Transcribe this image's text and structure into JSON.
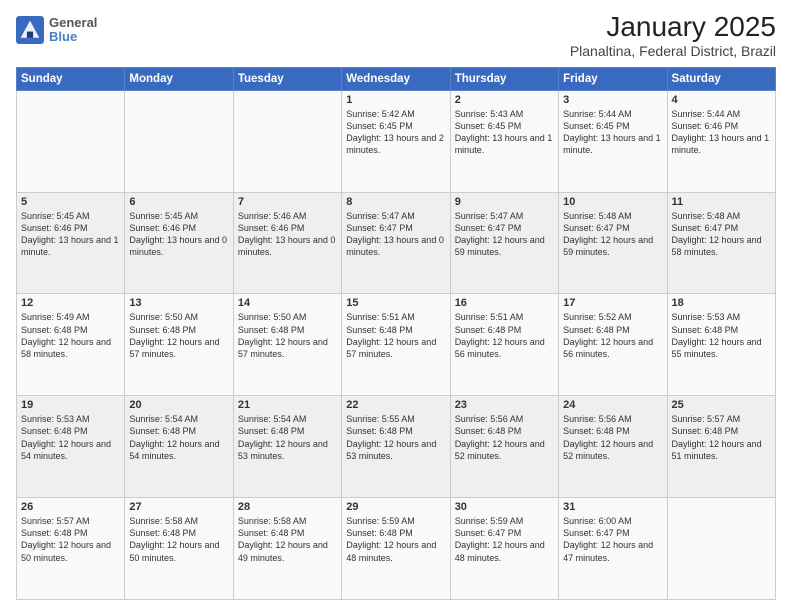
{
  "logo": {
    "line1": "General",
    "line2": "Blue"
  },
  "title": "January 2025",
  "subtitle": "Planaltina, Federal District, Brazil",
  "weekdays": [
    "Sunday",
    "Monday",
    "Tuesday",
    "Wednesday",
    "Thursday",
    "Friday",
    "Saturday"
  ],
  "weeks": [
    [
      {
        "day": "",
        "text": ""
      },
      {
        "day": "",
        "text": ""
      },
      {
        "day": "",
        "text": ""
      },
      {
        "day": "1",
        "text": "Sunrise: 5:42 AM\nSunset: 6:45 PM\nDaylight: 13 hours\nand 2 minutes."
      },
      {
        "day": "2",
        "text": "Sunrise: 5:43 AM\nSunset: 6:45 PM\nDaylight: 13 hours\nand 1 minute."
      },
      {
        "day": "3",
        "text": "Sunrise: 5:44 AM\nSunset: 6:45 PM\nDaylight: 13 hours\nand 1 minute."
      },
      {
        "day": "4",
        "text": "Sunrise: 5:44 AM\nSunset: 6:46 PM\nDaylight: 13 hours\nand 1 minute."
      }
    ],
    [
      {
        "day": "5",
        "text": "Sunrise: 5:45 AM\nSunset: 6:46 PM\nDaylight: 13 hours\nand 1 minute."
      },
      {
        "day": "6",
        "text": "Sunrise: 5:45 AM\nSunset: 6:46 PM\nDaylight: 13 hours\nand 0 minutes."
      },
      {
        "day": "7",
        "text": "Sunrise: 5:46 AM\nSunset: 6:46 PM\nDaylight: 13 hours\nand 0 minutes."
      },
      {
        "day": "8",
        "text": "Sunrise: 5:47 AM\nSunset: 6:47 PM\nDaylight: 13 hours\nand 0 minutes."
      },
      {
        "day": "9",
        "text": "Sunrise: 5:47 AM\nSunset: 6:47 PM\nDaylight: 12 hours\nand 59 minutes."
      },
      {
        "day": "10",
        "text": "Sunrise: 5:48 AM\nSunset: 6:47 PM\nDaylight: 12 hours\nand 59 minutes."
      },
      {
        "day": "11",
        "text": "Sunrise: 5:48 AM\nSunset: 6:47 PM\nDaylight: 12 hours\nand 58 minutes."
      }
    ],
    [
      {
        "day": "12",
        "text": "Sunrise: 5:49 AM\nSunset: 6:48 PM\nDaylight: 12 hours\nand 58 minutes."
      },
      {
        "day": "13",
        "text": "Sunrise: 5:50 AM\nSunset: 6:48 PM\nDaylight: 12 hours\nand 57 minutes."
      },
      {
        "day": "14",
        "text": "Sunrise: 5:50 AM\nSunset: 6:48 PM\nDaylight: 12 hours\nand 57 minutes."
      },
      {
        "day": "15",
        "text": "Sunrise: 5:51 AM\nSunset: 6:48 PM\nDaylight: 12 hours\nand 57 minutes."
      },
      {
        "day": "16",
        "text": "Sunrise: 5:51 AM\nSunset: 6:48 PM\nDaylight: 12 hours\nand 56 minutes."
      },
      {
        "day": "17",
        "text": "Sunrise: 5:52 AM\nSunset: 6:48 PM\nDaylight: 12 hours\nand 56 minutes."
      },
      {
        "day": "18",
        "text": "Sunrise: 5:53 AM\nSunset: 6:48 PM\nDaylight: 12 hours\nand 55 minutes."
      }
    ],
    [
      {
        "day": "19",
        "text": "Sunrise: 5:53 AM\nSunset: 6:48 PM\nDaylight: 12 hours\nand 54 minutes."
      },
      {
        "day": "20",
        "text": "Sunrise: 5:54 AM\nSunset: 6:48 PM\nDaylight: 12 hours\nand 54 minutes."
      },
      {
        "day": "21",
        "text": "Sunrise: 5:54 AM\nSunset: 6:48 PM\nDaylight: 12 hours\nand 53 minutes."
      },
      {
        "day": "22",
        "text": "Sunrise: 5:55 AM\nSunset: 6:48 PM\nDaylight: 12 hours\nand 53 minutes."
      },
      {
        "day": "23",
        "text": "Sunrise: 5:56 AM\nSunset: 6:48 PM\nDaylight: 12 hours\nand 52 minutes."
      },
      {
        "day": "24",
        "text": "Sunrise: 5:56 AM\nSunset: 6:48 PM\nDaylight: 12 hours\nand 52 minutes."
      },
      {
        "day": "25",
        "text": "Sunrise: 5:57 AM\nSunset: 6:48 PM\nDaylight: 12 hours\nand 51 minutes."
      }
    ],
    [
      {
        "day": "26",
        "text": "Sunrise: 5:57 AM\nSunset: 6:48 PM\nDaylight: 12 hours\nand 50 minutes."
      },
      {
        "day": "27",
        "text": "Sunrise: 5:58 AM\nSunset: 6:48 PM\nDaylight: 12 hours\nand 50 minutes."
      },
      {
        "day": "28",
        "text": "Sunrise: 5:58 AM\nSunset: 6:48 PM\nDaylight: 12 hours\nand 49 minutes."
      },
      {
        "day": "29",
        "text": "Sunrise: 5:59 AM\nSunset: 6:48 PM\nDaylight: 12 hours\nand 48 minutes."
      },
      {
        "day": "30",
        "text": "Sunrise: 5:59 AM\nSunset: 6:47 PM\nDaylight: 12 hours\nand 48 minutes."
      },
      {
        "day": "31",
        "text": "Sunrise: 6:00 AM\nSunset: 6:47 PM\nDaylight: 12 hours\nand 47 minutes."
      },
      {
        "day": "",
        "text": ""
      }
    ]
  ]
}
